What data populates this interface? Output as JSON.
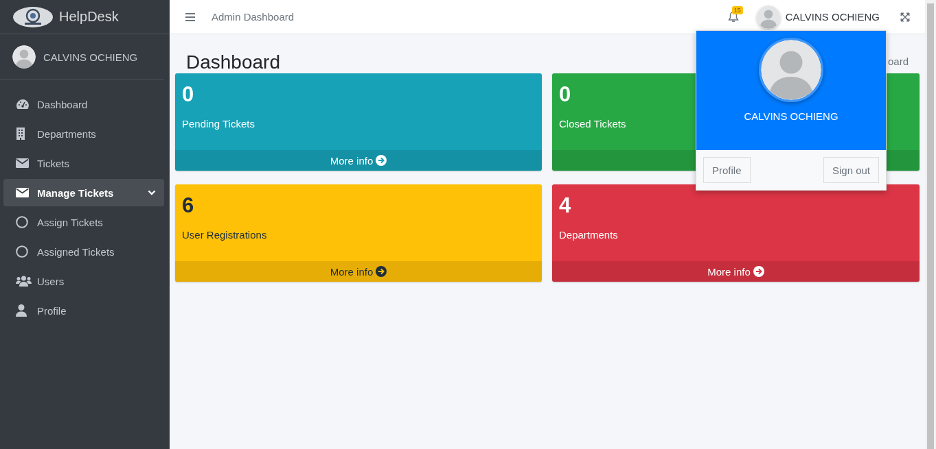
{
  "sidebar": {
    "brand": "HelpDesk",
    "user": "CALVINS OCHIENG",
    "items": [
      {
        "label": "Dashboard",
        "kind": "gauge",
        "selected": false
      },
      {
        "label": "Departments",
        "kind": "building",
        "selected": false
      },
      {
        "label": "Tickets",
        "kind": "envelope",
        "selected": false
      },
      {
        "label": "Manage Tickets",
        "kind": "envelope",
        "selected": true,
        "expanded": true,
        "children": [
          {
            "label": "Assign Tickets",
            "kind": "circle",
            "selected": false
          },
          {
            "label": "Assigned Tickets",
            "kind": "circle",
            "selected": false
          }
        ]
      },
      {
        "label": "Users",
        "kind": "users",
        "selected": false
      },
      {
        "label": "Profile",
        "kind": "user",
        "selected": false
      }
    ]
  },
  "topbar": {
    "title": "Admin Dashboard",
    "notification_count": "15",
    "user": "CALVINS OCHIENG"
  },
  "page": {
    "title": "Dashboard",
    "breadcrumb": "oard"
  },
  "boxes": [
    {
      "value": "0",
      "label": "Pending Tickets",
      "color": "#17a2b8",
      "more_info": "More info"
    },
    {
      "value": "0",
      "label": "Closed Tickets",
      "color": "#28a745"
    },
    {
      "value": "6",
      "label": "User Registrations",
      "color": "#ffc107",
      "more_info": "More info"
    },
    {
      "value": "4",
      "label": "Departments",
      "color": "#dc3545",
      "more_info": "More info"
    }
  ],
  "user_menu": {
    "open": true,
    "name": "CALVINS OCHIENG",
    "buttons": [
      "Profile",
      "Sign out"
    ]
  }
}
